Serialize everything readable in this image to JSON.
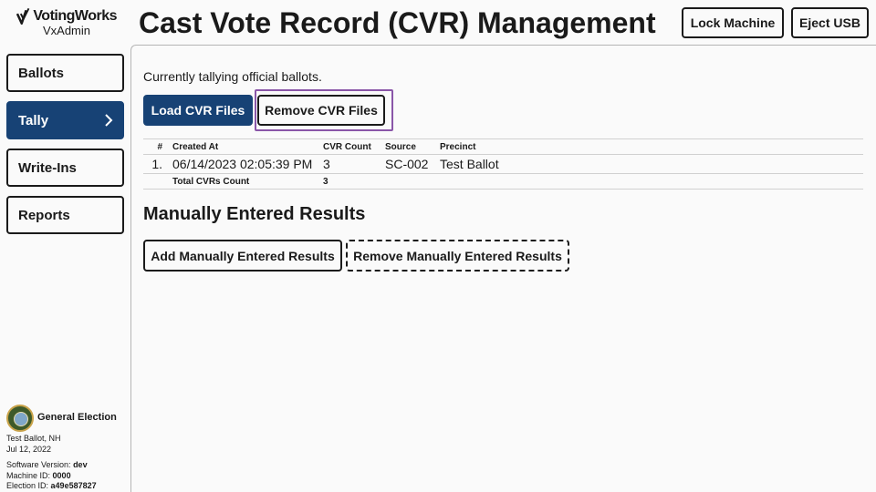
{
  "brand": {
    "name": "VotingWorks",
    "product": "VxAdmin"
  },
  "header": {
    "title": "Cast Vote Record (CVR) Management",
    "lock_label": "Lock Machine",
    "eject_label": "Eject USB"
  },
  "nav": {
    "items": [
      {
        "label": "Ballots",
        "active": false
      },
      {
        "label": "Tally",
        "active": true
      },
      {
        "label": "Write-Ins",
        "active": false
      },
      {
        "label": "Reports",
        "active": false
      }
    ]
  },
  "election": {
    "title": "General Election",
    "location": "Test Ballot, NH",
    "date": "Jul 12, 2022",
    "software_label": "Software Version:",
    "software_value": "dev",
    "machine_label": "Machine ID:",
    "machine_value": "0000",
    "election_label": "Election ID:",
    "election_value": "a49e587827"
  },
  "main": {
    "status": "Currently tallying official ballots.",
    "load_label": "Load CVR Files",
    "remove_label": "Remove CVR Files",
    "table": {
      "headers": [
        "#",
        "Created At",
        "CVR Count",
        "Source",
        "Precinct"
      ],
      "rows": [
        {
          "num": "1.",
          "created": "06/14/2023 02:05:39 PM",
          "count": "3",
          "source": "SC-002",
          "precinct": "Test Ballot"
        }
      ],
      "total_label": "Total CVRs Count",
      "total_value": "3"
    },
    "manual_title": "Manually Entered Results",
    "add_manual_label": "Add Manually Entered Results",
    "remove_manual_label": "Remove Manually Entered Results"
  },
  "colors": {
    "primary": "#174275",
    "focus": "#8a56a8"
  },
  "icons": {
    "nav_active": "chevron-right-icon",
    "logo": "checkmark-logo-icon",
    "seal": "state-seal-icon"
  }
}
